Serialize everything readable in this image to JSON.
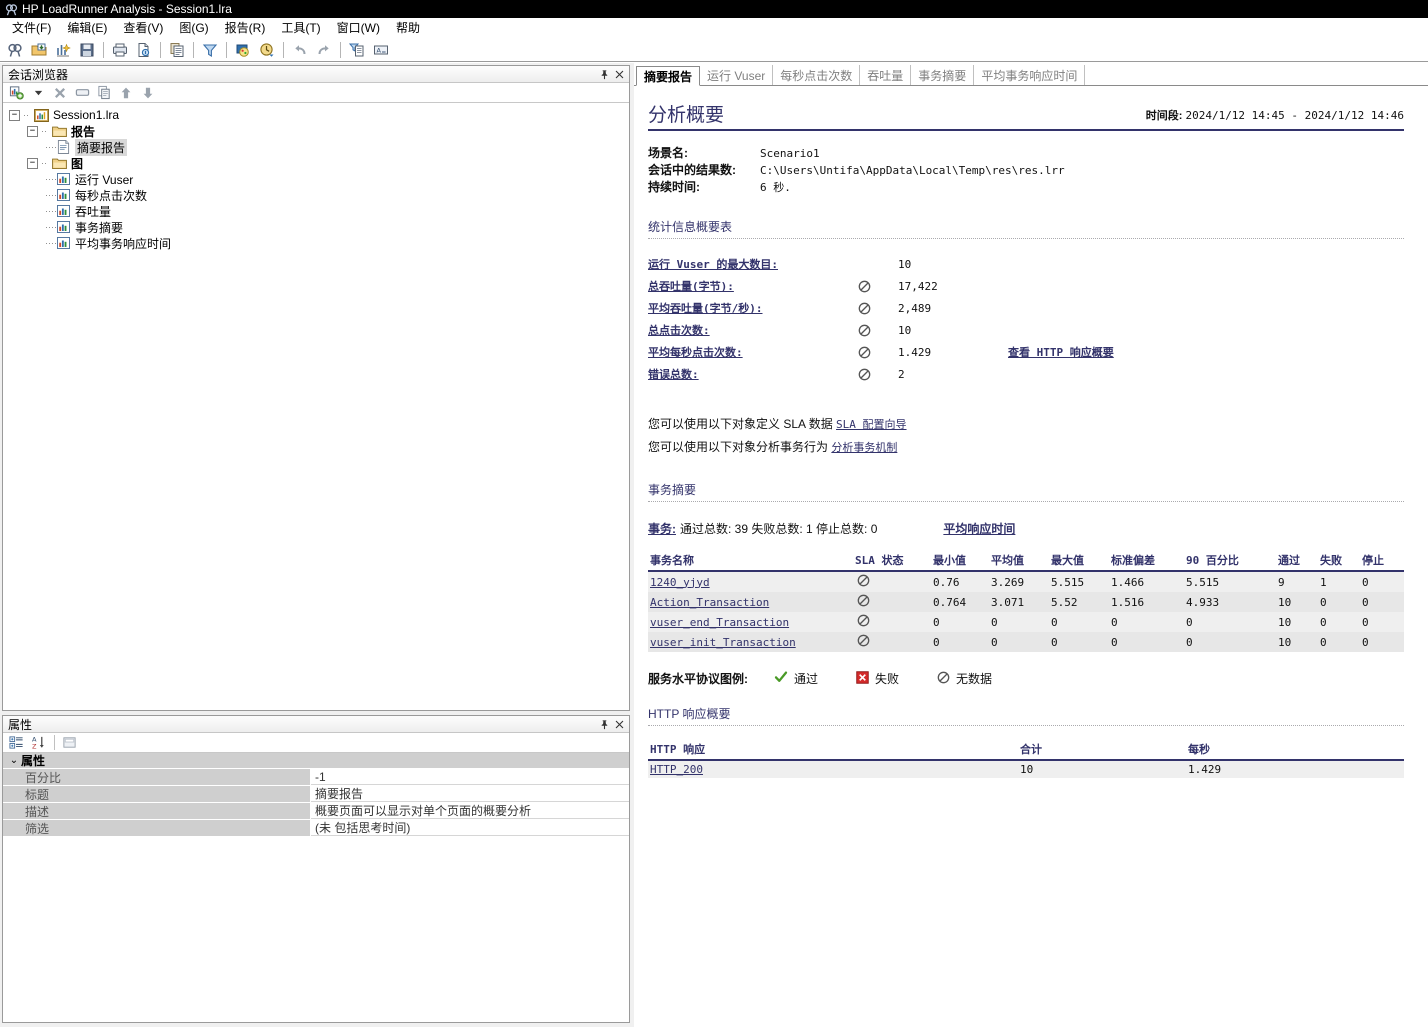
{
  "window": {
    "title": "HP LoadRunner Analysis - Session1.lra",
    "app_icon": "loadrunner-icon"
  },
  "menubar": {
    "items": [
      {
        "label": "文件(F)",
        "name": "menu-file"
      },
      {
        "label": "编辑(E)",
        "name": "menu-edit"
      },
      {
        "label": "查看(V)",
        "name": "menu-view"
      },
      {
        "label": "图(G)",
        "name": "menu-graph"
      },
      {
        "label": "报告(R)",
        "name": "menu-report"
      },
      {
        "label": "工具(T)",
        "name": "menu-tools"
      },
      {
        "label": "窗口(W)",
        "name": "menu-window"
      },
      {
        "label": "帮助",
        "name": "menu-help"
      }
    ]
  },
  "toolbar": {
    "buttons": [
      {
        "name": "new-session-icon",
        "glyph": "loadrunner"
      },
      {
        "name": "open-session-icon",
        "glyph": "folder-open"
      },
      {
        "name": "new-graph-icon",
        "glyph": "graph-new"
      },
      {
        "name": "save-icon",
        "glyph": "floppy"
      },
      {
        "name": "print-icon",
        "glyph": "printer"
      },
      {
        "name": "print-preview-icon",
        "glyph": "doc-preview"
      },
      {
        "name": "copy-to-clipboard-icon",
        "glyph": "clipboard"
      },
      {
        "name": "filter-icon",
        "glyph": "funnel"
      },
      {
        "name": "set-granularity-icon",
        "glyph": "palette"
      },
      {
        "name": "auto-correlate-icon",
        "glyph": "clock"
      },
      {
        "name": "undo-icon",
        "glyph": "undo"
      },
      {
        "name": "redo-icon",
        "glyph": "redo"
      },
      {
        "name": "summary-filter-icon",
        "glyph": "doc-filter"
      },
      {
        "name": "add-comment-icon",
        "glyph": "label"
      }
    ]
  },
  "session_browser": {
    "title": "会话浏览器",
    "toolbar": [
      {
        "name": "add-graph-icon"
      },
      {
        "name": "dropdown-arrow-icon"
      },
      {
        "name": "delete-icon"
      },
      {
        "name": "rename-icon"
      },
      {
        "name": "duplicate-icon"
      },
      {
        "name": "move-up-icon"
      },
      {
        "name": "move-down-icon"
      }
    ],
    "tree": {
      "root": {
        "label": "Session1.lra",
        "icon": "session-icon"
      },
      "groups": [
        {
          "label": "报告",
          "icon": "folder-icon",
          "children": [
            {
              "label": "摘要报告",
              "icon": "report-icon",
              "selected": true
            }
          ]
        },
        {
          "label": "图",
          "icon": "folder-icon",
          "children": [
            {
              "label": "运行 Vuser",
              "icon": "chart-icon"
            },
            {
              "label": "每秒点击次数",
              "icon": "chart-icon"
            },
            {
              "label": "吞吐量",
              "icon": "chart-icon"
            },
            {
              "label": "事务摘要",
              "icon": "chart-icon"
            },
            {
              "label": "平均事务响应时间",
              "icon": "chart-icon"
            }
          ]
        }
      ]
    },
    "pin_label": "固定",
    "close_label": "关闭"
  },
  "properties_panel": {
    "title": "属性",
    "toolbar": [
      {
        "name": "categorized-view-icon"
      },
      {
        "name": "alphabetical-sort-icon"
      },
      {
        "name": "property-pages-icon"
      }
    ],
    "category": "属性",
    "rows": [
      {
        "name": "百分比",
        "value": "-1"
      },
      {
        "name": "标题",
        "value": "摘要报告"
      },
      {
        "name": "描述",
        "value": "概要页面可以显示对单个页面的概要分析"
      },
      {
        "name": "筛选",
        "value": "(未 包括思考时间)"
      }
    ]
  },
  "tabs": [
    {
      "label": "摘要报告",
      "active": true
    },
    {
      "label": "运行 Vuser",
      "active": false
    },
    {
      "label": "每秒点击次数",
      "active": false
    },
    {
      "label": "吞吐量",
      "active": false
    },
    {
      "label": "事务摘要",
      "active": false
    },
    {
      "label": "平均事务响应时间",
      "active": false
    }
  ],
  "report": {
    "title": "分析概要",
    "period_label": "时间段:",
    "period_value": "2024/1/12 14:45 - 2024/1/12 14:46",
    "info": [
      {
        "key": "场景名:",
        "value": "Scenario1"
      },
      {
        "key": "会话中的结果数:",
        "value": "C:\\Users\\Untifa\\AppData\\Local\\Temp\\res\\res.lrr"
      },
      {
        "key": "持续时间:",
        "value": "6 秒."
      }
    ],
    "stats_section_title": "统计信息概要表",
    "stats": [
      {
        "label": "运行 Vuser 的最大数目:",
        "icon": "",
        "value": "10",
        "extra": ""
      },
      {
        "label": "总吞吐量(字节):",
        "icon": "no-data-icon",
        "value": "17,422",
        "extra": ""
      },
      {
        "label": "平均吞吐量(字节/秒):",
        "icon": "no-data-icon",
        "value": "2,489",
        "extra": ""
      },
      {
        "label": "总点击次数:",
        "icon": "no-data-icon",
        "value": "10",
        "extra": ""
      },
      {
        "label": "平均每秒点击次数:",
        "icon": "no-data-icon",
        "value": "1.429",
        "extra": "查看 HTTP 响应概要"
      },
      {
        "label": "错误总数:",
        "icon": "no-data-icon",
        "value": "2",
        "extra": ""
      }
    ],
    "sla_lines": [
      {
        "text": "您可以使用以下对象定义 SLA 数据 ",
        "link": "SLA 配置向导"
      },
      {
        "text": "您可以使用以下对象分析事务行为 ",
        "link": "分析事务机制"
      }
    ],
    "transaction_section_title": "事务摘要",
    "transaction_summary": {
      "link": "事务:",
      "text": "通过总数: 39 失败总数: 1 停止总数: 0",
      "avg_link": "平均响应时间"
    },
    "transaction_table": {
      "headers": [
        "事务名称",
        "SLA 状态",
        "最小值",
        "平均值",
        "最大值",
        "标准偏差",
        "90 百分比",
        "通过",
        "失败",
        "停止"
      ],
      "rows": [
        {
          "name": "1240_yjyd",
          "sla": "no-data-icon",
          "min": "0.76",
          "avg": "3.269",
          "max": "5.515",
          "std": "1.466",
          "p90": "5.515",
          "pass": "9",
          "fail": "1",
          "stop": "0"
        },
        {
          "name": "Action_Transaction",
          "sla": "no-data-icon",
          "min": "0.764",
          "avg": "3.071",
          "max": "5.52",
          "std": "1.516",
          "p90": "4.933",
          "pass": "10",
          "fail": "0",
          "stop": "0"
        },
        {
          "name": "vuser_end_Transaction",
          "sla": "no-data-icon",
          "min": "0",
          "avg": "0",
          "max": "0",
          "std": "0",
          "p90": "0",
          "pass": "10",
          "fail": "0",
          "stop": "0"
        },
        {
          "name": "vuser_init_Transaction",
          "sla": "no-data-icon",
          "min": "0",
          "avg": "0",
          "max": "0",
          "std": "0",
          "p90": "0",
          "pass": "10",
          "fail": "0",
          "stop": "0"
        }
      ]
    },
    "sla_legend": {
      "title": "服务水平协议图例:",
      "items": [
        {
          "icon": "check-icon",
          "label": "通过",
          "color": "#4a9a27"
        },
        {
          "icon": "fail-x-icon",
          "label": "失败",
          "color": "#d42b2b"
        },
        {
          "icon": "no-data-icon",
          "label": "无数据",
          "color": "#666666"
        }
      ]
    },
    "http_section_title": "HTTP 响应概要",
    "http_table": {
      "headers": [
        "HTTP 响应",
        "合计",
        "每秒"
      ],
      "rows": [
        {
          "code": "HTTP_200",
          "total": "10",
          "per_sec": "1.429"
        }
      ]
    }
  },
  "colors": {
    "accent": "#33336b",
    "title_bar_bg": "#000000",
    "panel_bg": "#f0f0f0",
    "table_row_bg": "#efefef"
  }
}
